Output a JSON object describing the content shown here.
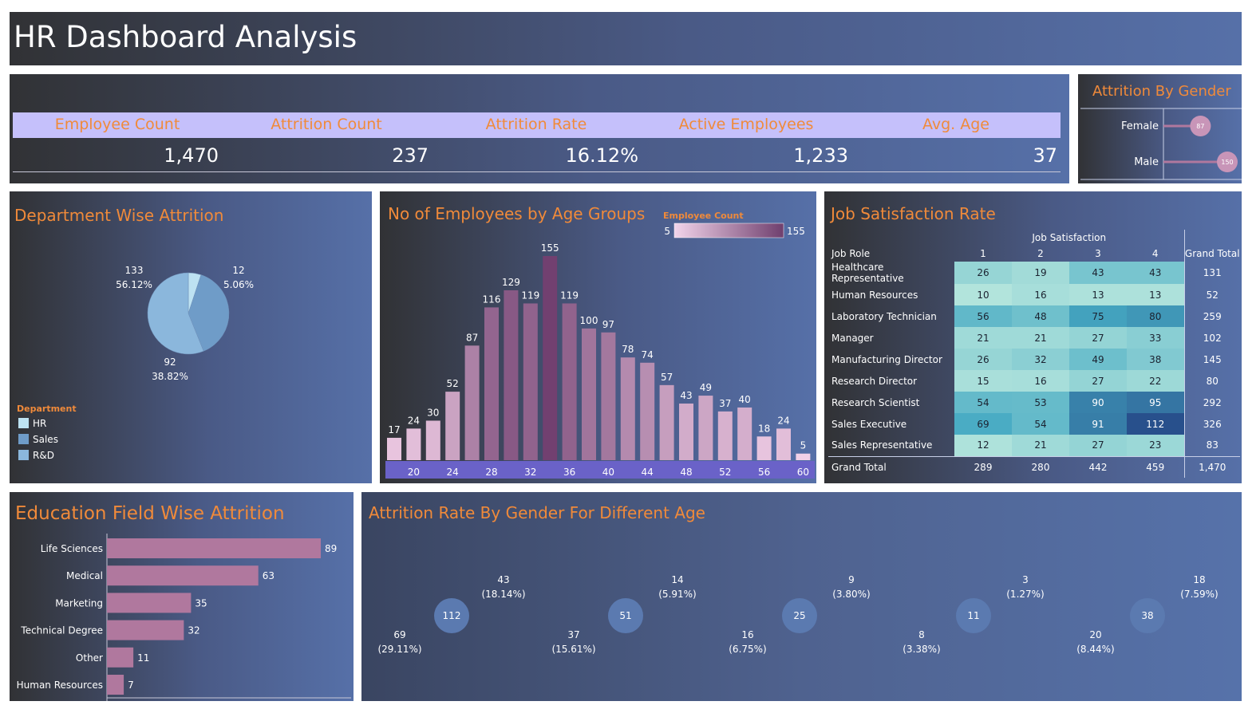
{
  "dashboard": {
    "title": "HR Dashboard Analysis"
  },
  "kpis": [
    {
      "label": "Employee Count",
      "value": "1,470"
    },
    {
      "label": "Attrition Count",
      "value": "237"
    },
    {
      "label": "Attrition Rate",
      "value": "16.12%"
    },
    {
      "label": "Active Employees",
      "value": "1,233"
    },
    {
      "label": "Avg. Age",
      "value": "37"
    }
  ],
  "colors": {
    "accent": "#f08a3a",
    "kpi_band": "#c5c0fb",
    "bar_pink": "#b0789e",
    "axis_band": "#6a62c8",
    "hr": "#bde2f2",
    "sales": "#6f9cc8",
    "rnd": "#8bb7dc"
  },
  "chart_data": [
    {
      "id": "attrition_by_gender",
      "type": "bar",
      "title": "Attrition By Gender",
      "categories": [
        "Female",
        "Male"
      ],
      "values": [
        87,
        150
      ],
      "value_labels": [
        "87",
        "150"
      ]
    },
    {
      "id": "department_attrition",
      "type": "pie",
      "title": "Department Wise Attrition",
      "legend_title": "Department",
      "legend_position": "bottom-left",
      "slices": [
        {
          "name": "HR",
          "value": 12,
          "count_label": "12",
          "pct_label": "5.06%"
        },
        {
          "name": "Sales",
          "value": 92,
          "count_label": "92",
          "pct_label": "38.82%"
        },
        {
          "name": "R&D",
          "value": 133,
          "count_label": "133",
          "pct_label": "56.12%"
        }
      ]
    },
    {
      "id": "age_groups",
      "type": "bar",
      "title": "No of Employees by Age Groups",
      "legend_title": "Employee Count",
      "color_range": [
        "5",
        "155"
      ],
      "x_ticks": [
        "20",
        "24",
        "28",
        "32",
        "36",
        "40",
        "44",
        "48",
        "52",
        "56",
        "60"
      ],
      "values": [
        17,
        24,
        30,
        52,
        87,
        116,
        129,
        119,
        155,
        119,
        100,
        97,
        78,
        74,
        57,
        43,
        49,
        37,
        40,
        18,
        24,
        5
      ],
      "ylim": [
        0,
        155
      ]
    },
    {
      "id": "job_satisfaction",
      "type": "heatmap",
      "title": "Job Satisfaction Rate",
      "column_group": "Job Satisfaction",
      "row_header": "Job Role",
      "columns": [
        "1",
        "2",
        "3",
        "4"
      ],
      "total_header": "Grand Total",
      "rows": [
        {
          "role": "Healthcare Representative",
          "values": [
            26,
            19,
            43,
            43
          ],
          "total": "131"
        },
        {
          "role": "Human Resources",
          "values": [
            10,
            16,
            13,
            13
          ],
          "total": "52"
        },
        {
          "role": "Laboratory Technician",
          "values": [
            56,
            48,
            75,
            80
          ],
          "total": "259"
        },
        {
          "role": "Manager",
          "values": [
            21,
            21,
            27,
            33
          ],
          "total": "102"
        },
        {
          "role": "Manufacturing Director",
          "values": [
            26,
            32,
            49,
            38
          ],
          "total": "145"
        },
        {
          "role": "Research Director",
          "values": [
            15,
            16,
            27,
            22
          ],
          "total": "80"
        },
        {
          "role": "Research Scientist",
          "values": [
            54,
            53,
            90,
            95
          ],
          "total": "292"
        },
        {
          "role": "Sales Executive",
          "values": [
            69,
            54,
            91,
            112
          ],
          "total": "326"
        },
        {
          "role": "Sales Representative",
          "values": [
            12,
            21,
            27,
            23
          ],
          "total": "83"
        }
      ],
      "grand_total": {
        "label": "Grand Total",
        "values": [
          "289",
          "280",
          "442",
          "459"
        ],
        "total": "1,470"
      }
    },
    {
      "id": "education_field_attrition",
      "type": "bar",
      "title": "Education Field Wise Attrition",
      "categories": [
        "Life Sciences",
        "Medical",
        "Marketing",
        "Technical Degree",
        "Other",
        "Human Resources"
      ],
      "values": [
        89,
        63,
        35,
        32,
        11,
        7
      ]
    },
    {
      "id": "attrition_gender_age",
      "type": "pie",
      "title": "Attrition Rate By Gender For Different Age",
      "donuts": [
        {
          "total": "112",
          "female": 43,
          "female_pct": "(18.14%)",
          "male": 69,
          "male_pct": "(29.11%)"
        },
        {
          "total": "51",
          "female": 14,
          "female_pct": "(5.91%)",
          "male": 37,
          "male_pct": "(15.61%)"
        },
        {
          "total": "25",
          "female": 9,
          "female_pct": "(3.80%)",
          "male": 16,
          "male_pct": "(6.75%)"
        },
        {
          "total": "11",
          "female": 3,
          "female_pct": "(1.27%)",
          "male": 8,
          "male_pct": "(3.38%)"
        },
        {
          "total": "38",
          "female": 18,
          "female_pct": "(7.59%)",
          "male": 20,
          "male_pct": "(8.44%)"
        }
      ]
    }
  ]
}
